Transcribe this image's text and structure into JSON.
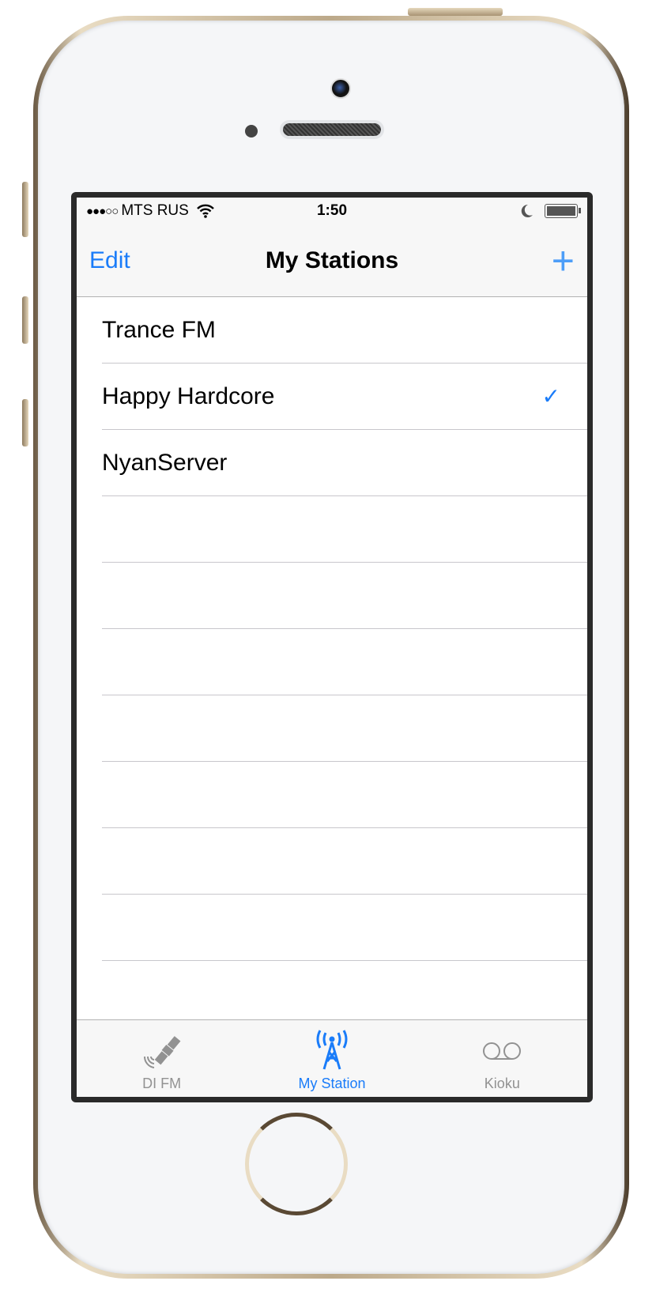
{
  "status_bar": {
    "signal": "●●●○○",
    "carrier": "MTS RUS",
    "time": "1:50"
  },
  "nav": {
    "edit_label": "Edit",
    "title": "My Stations",
    "add_label": "+"
  },
  "stations": [
    {
      "name": "Trance FM",
      "selected": false
    },
    {
      "name": "Happy Hardcore",
      "selected": true,
      "check": "✓"
    },
    {
      "name": "NyanServer",
      "selected": false
    }
  ],
  "tabs": [
    {
      "label": "DI FM",
      "icon": "satellite-icon",
      "active": false
    },
    {
      "label": "My Station",
      "icon": "radio-tower-icon",
      "active": true
    },
    {
      "label": "Kioku",
      "icon": "voicemail-icon",
      "active": false
    }
  ],
  "colors": {
    "accent": "#1a7cf9",
    "inactive": "#929292"
  }
}
